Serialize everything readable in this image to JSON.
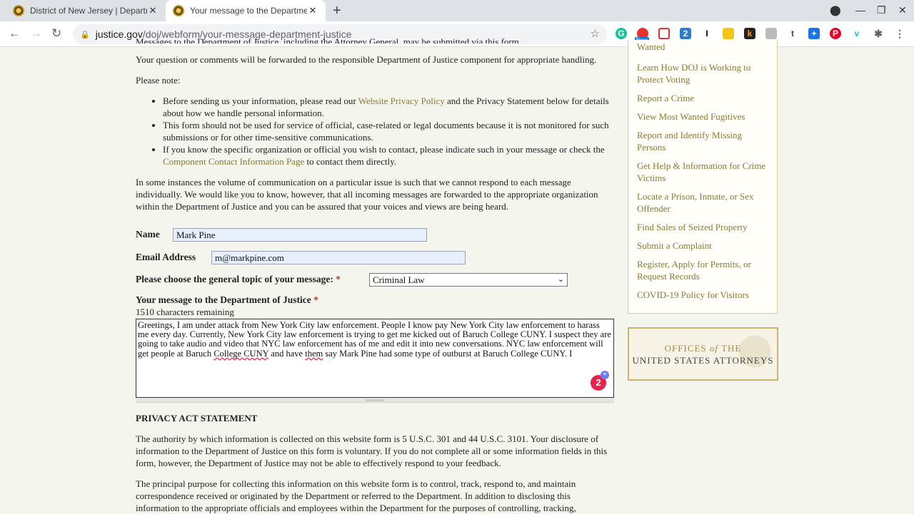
{
  "browser": {
    "tabs": [
      {
        "title": "District of New Jersey | Departm",
        "active": false
      },
      {
        "title": "Your message to the Departmen",
        "active": true
      }
    ],
    "new_tab": "+",
    "url_host": "justice.gov",
    "url_path": "/doj/webform/your-message-department-justice",
    "ext_new_badge": "New"
  },
  "intro": {
    "cut_line": "Messages to the Department of Justice, including the Attorney General, may be submitted via this form.",
    "forward": "Your question or comments will be forwarded to the responsible Department of Justice component for appropriate handling.",
    "please_note": "Please note:",
    "bullet1_pre": "Before sending us your information, please read our ",
    "bullet1_link": "Website Privacy Policy",
    "bullet1_post": " and the Privacy Statement below for details about how we handle personal information.",
    "bullet2": "This form should not be used for service of official, case-related or legal documents because it is not monitored for such submissions or for other time-sensitive communications.",
    "bullet3_pre": "If you know the specific organization or official you wish to contact, please indicate such in your message or check the ",
    "bullet3_link": "Component Contact Information Page",
    "bullet3_post": " to contact them directly.",
    "volume": "In some instances the volume of  communication on a particular issue is such that we cannot respond to each message individually. We would like you to know, however, that all incoming messages are forwarded to the appropriate organization within the Department of Justice and you can be assured that your voices and views are being heard."
  },
  "form": {
    "name_label": "Name",
    "name_value": "Mark Pine",
    "email_label": "Email Address",
    "email_value": "m@markpine.com",
    "topic_label": "Please choose the general topic of your message:",
    "topic_value": "Criminal Law",
    "required_mark": "*",
    "message_label": "Your message to the Department of Justice",
    "chars_remaining": "1510 characters remaining",
    "message_part1": "Greetings, I am under attack from New York City law enforcement. People I know pay New York City law enforcement to harass me every day. Currently, New York City law enforcement is trying to get me kicked out of Baruch College CUNY. I suspect they are going to take audio and video that NYC law enforcement has of me and edit it into new conversations. NYC law enforcement will get people at Baruch ",
    "message_flag1": "College CUNY",
    "message_part2": " and have ",
    "message_flag2": "them",
    "message_part3": " say Mark Pine had some type of outburst at Baruch College CUNY. I",
    "grammarly_count": "2"
  },
  "privacy": {
    "heading": "PRIVACY ACT STATEMENT",
    "p1": "The authority by which information is collected on this website form is 5 U.S.C. 301 and 44 U.S.C. 3101.  Your disclosure of information to the Department of Justice on this form is voluntary.  If you do not complete all or some information fields in this form, however, the Department of Justice may not be able to effectively respond to your feedback.",
    "p2": "The principal purpose for collecting this information on this website form is to control, track, respond to, and maintain correspondence received or originated by the Department or referred to the Department.  In addition to disclosing this information to the appropriate officials and employees within the Department for the purposes of controlling, tracking,"
  },
  "sidebar": {
    "items": [
      "Wanted",
      "Learn How DOJ is Working to Protect Voting",
      "Report a Crime",
      "View Most Wanted Fugitives",
      "Report and Identify Missing Persons",
      "Get Help & Information for Crime Victims",
      "Locate a Prison, Inmate, or Sex Offender",
      "Find Sales of Seized Property",
      "Submit a Complaint",
      "Register, Apply for Permits, or Request Records",
      "COVID-19 Policy for Visitors"
    ],
    "banner_line1_a": "OFFICES",
    "banner_line1_b": "of",
    "banner_line1_c": "THE",
    "banner_line2": "UNITED STATES ATTORNEYS"
  },
  "colors": {
    "link": "#8a7a33",
    "page_bg": "#f4f6ee",
    "required": "#c0392b"
  }
}
